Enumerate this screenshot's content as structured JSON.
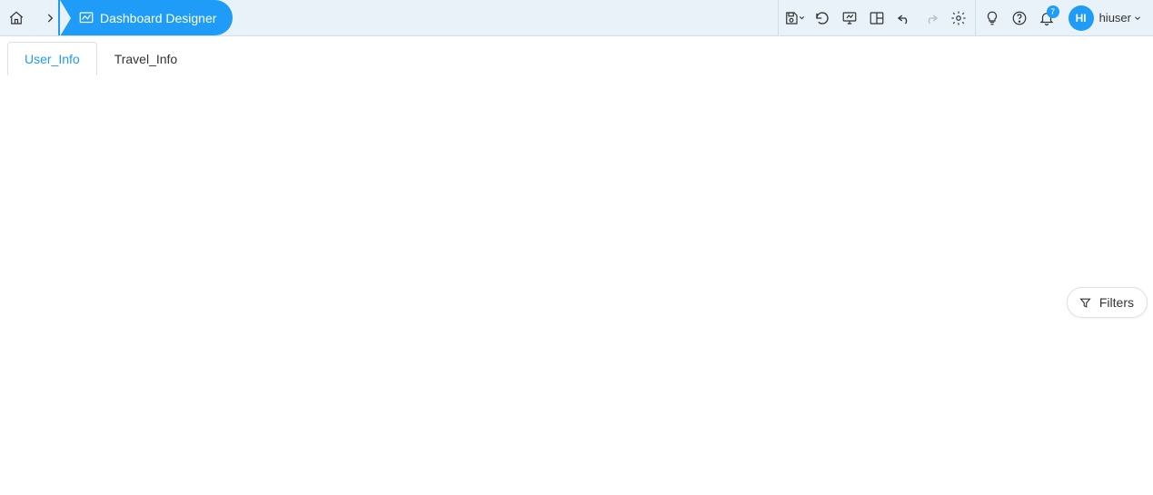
{
  "header": {
    "current_page": "Dashboard Designer"
  },
  "tabs": [
    {
      "label": "User_Info",
      "active": true
    },
    {
      "label": "Travel_Info",
      "active": false
    }
  ],
  "notifications": {
    "count": "7"
  },
  "user": {
    "initials": "HI",
    "name": "hiuser"
  },
  "filters": {
    "label": "Filters"
  }
}
